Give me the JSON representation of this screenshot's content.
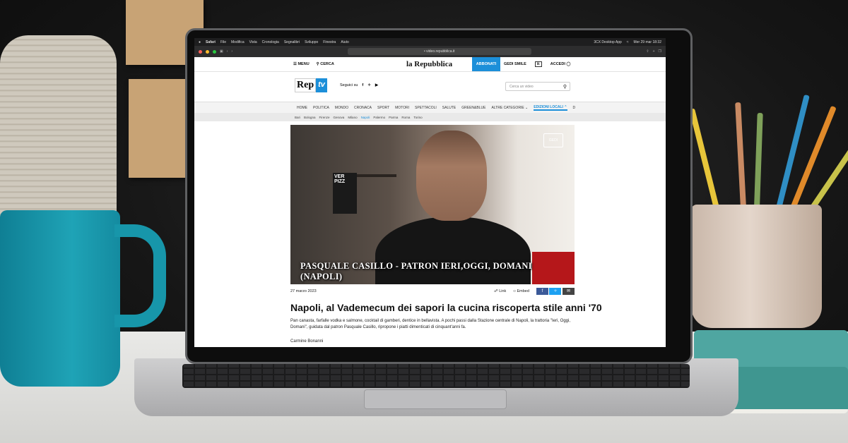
{
  "menubar": {
    "app": "Safari",
    "items": [
      "File",
      "Modifica",
      "Vista",
      "Cronologia",
      "Segnalibri",
      "Sviluppo",
      "Finestra",
      "Aiuto"
    ],
    "status_app": "3CX Desktop App",
    "datetime": "Mer 29 mar 18:32"
  },
  "browser": {
    "url": "video.repubblica.it"
  },
  "site": {
    "menu_label": "MENU",
    "search_label": "CERCA",
    "logo": "la Repubblica",
    "subscribe_label": "ABBONATI",
    "gedi_smile": "GEDI SMILE",
    "login_label": "ACCEDI",
    "rep": "Rep",
    "tv": "tv",
    "follow_label": "Seguici su",
    "video_search_placeholder": "Cerca un video",
    "categories": [
      "HOME",
      "POLITICA",
      "MONDO",
      "CRONACA",
      "SPORT",
      "MOTORI",
      "SPETTACOLI",
      "SALUTE",
      "GREEN&BLUE",
      "ALTRE CATEGORIE",
      "EDIZIONI LOCALI",
      "D"
    ],
    "cities": [
      "Bari",
      "Bologna",
      "Firenze",
      "Genova",
      "Milano",
      "Napoli",
      "Palermo",
      "Parma",
      "Roma",
      "Torino"
    ],
    "selected_city": "Napoli"
  },
  "video": {
    "caption": "PASQUALE CASILLO - PATRON IERI,OGGI, DOMANI (NAPOLI)",
    "logo": "GEDI",
    "sign_text": "VER PIZZ"
  },
  "article": {
    "date": "27 marzo 2023",
    "link_label": "Link",
    "embed_label": "Embed",
    "title": "Napoli, al Vademecum dei sapori la cucina riscoperta stile anni '70",
    "description": "Pan canasta, farfalle vodka e salmone, cocktail di gamberi, dentice in bellavista. A pochi passi dalla Stazione centrale di Napoli, la trattoria \"Ieri, Oggi, Domani\", guidata dal patron Pasquale Casillo, ripropone i piatti dimenticati di cinquant'anni fa.",
    "author": "Carmine Bonanni"
  },
  "colors": {
    "accent": "#1c8fd9",
    "facebook": "#3b5998",
    "twitter": "#1da1f2",
    "mail": "#444444"
  }
}
